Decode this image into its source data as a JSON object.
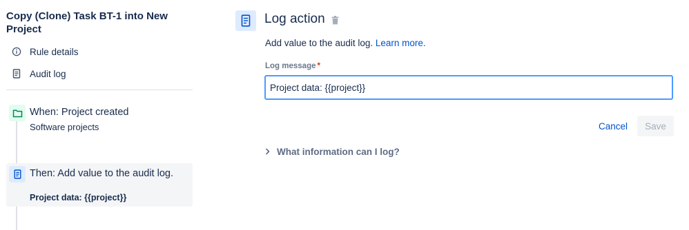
{
  "sidebar": {
    "rule_title": "Copy (Clone) Task BT-1 into New Project",
    "links": [
      {
        "label": "Rule details",
        "icon": "info-icon"
      },
      {
        "label": "Audit log",
        "icon": "document-icon"
      }
    ],
    "trigger": {
      "title": "When: Project created",
      "subtitle": "Software projects",
      "icon": "folder-icon"
    },
    "action": {
      "title": "Then: Add value to the audit log.",
      "subtitle": "Project data: {{project}}",
      "icon": "document-icon"
    }
  },
  "main": {
    "title": "Log action",
    "description": "Add value to the audit log.",
    "learn_more": "Learn more.",
    "field_label": "Log message",
    "required_marker": "*",
    "field_value": "Project data: {{project}}",
    "cancel_label": "Cancel",
    "save_label": "Save",
    "expander_label": "What information can I log?"
  },
  "colors": {
    "accent": "#0052cc",
    "focus_border": "#4c9aff",
    "required": "#de350b",
    "trigger_bg": "#e3fcef",
    "action_bg": "#deebff"
  }
}
